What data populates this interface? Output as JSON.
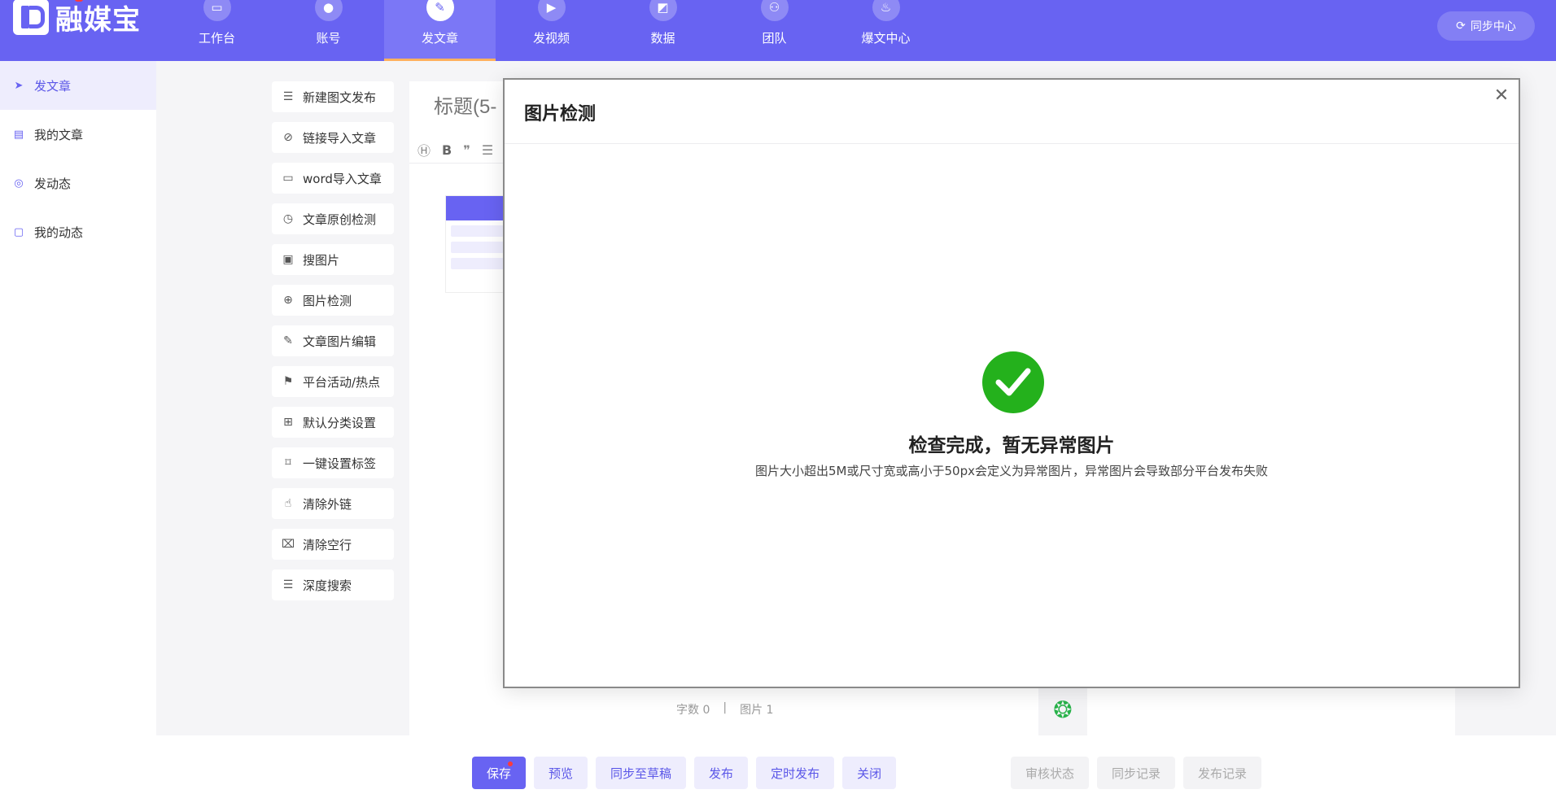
{
  "app": {
    "name": "融媒宝"
  },
  "nav": {
    "items": [
      {
        "label": "工作台",
        "icon": "monitor-icon"
      },
      {
        "label": "账号",
        "icon": "user-icon"
      },
      {
        "label": "发文章",
        "icon": "feather-icon"
      },
      {
        "label": "发视频",
        "icon": "play-icon"
      },
      {
        "label": "数据",
        "icon": "chart-icon"
      },
      {
        "label": "团队",
        "icon": "org-icon"
      },
      {
        "label": "爆文中心",
        "icon": "fire-icon"
      }
    ],
    "active": "发文章",
    "sync_center": "同步中心"
  },
  "sidebar": {
    "items": [
      {
        "label": "发文章",
        "icon": "send-icon"
      },
      {
        "label": "我的文章",
        "icon": "doc-icon"
      },
      {
        "label": "发动态",
        "icon": "target-icon"
      },
      {
        "label": "我的动态",
        "icon": "chat-icon"
      }
    ]
  },
  "tools": {
    "items": [
      {
        "label": "新建图文发布",
        "icon": "new-post-icon"
      },
      {
        "label": "链接导入文章",
        "icon": "link-icon"
      },
      {
        "label": "word导入文章",
        "icon": "word-import-icon"
      },
      {
        "label": "文章原创检测",
        "icon": "originality-icon"
      },
      {
        "label": "搜图片",
        "icon": "image-search-icon"
      },
      {
        "label": "图片检测",
        "icon": "zoom-icon"
      },
      {
        "label": "文章图片编辑",
        "icon": "edit-icon"
      },
      {
        "label": "平台活动/热点",
        "icon": "flag-icon"
      },
      {
        "label": "默认分类设置",
        "icon": "grid-icon"
      },
      {
        "label": "一键设置标签",
        "icon": "bookmark-icon"
      },
      {
        "label": "清除外链",
        "icon": "thumb-icon"
      },
      {
        "label": "清除空行",
        "icon": "trash-icon"
      },
      {
        "label": "深度搜索",
        "icon": "deep-search-icon"
      }
    ]
  },
  "editor": {
    "title_placeholder": "标题(5-",
    "stats": {
      "words": "字数 0",
      "separator": "|",
      "images": "图片 1"
    }
  },
  "bottom": {
    "save": "保存",
    "preview": "预览",
    "sync_draft": "同步至草稿",
    "publish": "发布",
    "schedule": "定时发布",
    "close": "关闭",
    "review_status": "审核状态",
    "sync_log": "同步记录",
    "publish_log": "发布记录"
  },
  "modal": {
    "title": "图片检测",
    "message": "检查完成，暂无异常图片",
    "sub": "图片大小超出5M或尺寸宽或高小于50px会定义为异常图片，异常图片会导致部分平台发布失败"
  },
  "colors": {
    "brand": "#6863f2",
    "success": "#24b11c",
    "accent": "#ffb15e"
  }
}
